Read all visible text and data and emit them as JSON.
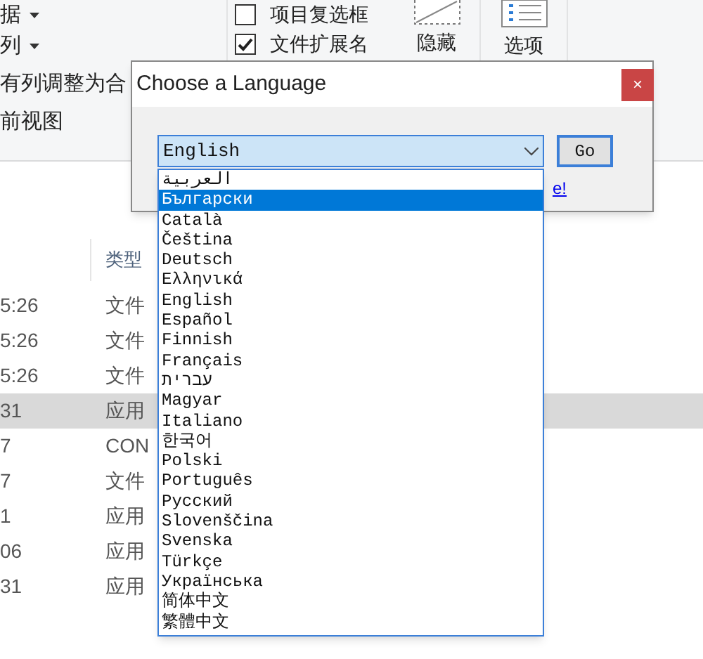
{
  "ribbon": {
    "commands": [
      {
        "label": "据",
        "dropdown": true
      },
      {
        "label": "列",
        "dropdown": true
      },
      {
        "label": "有列调整为合"
      },
      {
        "label": "前视图"
      }
    ],
    "checkboxes": [
      {
        "label": "项目复选框",
        "checked": false
      },
      {
        "label": "文件扩展名",
        "checked": true
      }
    ],
    "big_buttons": [
      {
        "label": "隐藏",
        "kind": "hide"
      },
      {
        "label": "选项",
        "kind": "options"
      }
    ]
  },
  "file_list": {
    "header": "类型",
    "rows": [
      {
        "time": "5:26",
        "type": "文件",
        "selected": false
      },
      {
        "time": "5:26",
        "type": "文件",
        "selected": false
      },
      {
        "time": "5:26",
        "type": "文件",
        "selected": false
      },
      {
        "time": "31",
        "type": "应用",
        "selected": true
      },
      {
        "time": "7",
        "type": "CON",
        "selected": false
      },
      {
        "time": "7",
        "type": "文件",
        "selected": false
      },
      {
        "time": "1",
        "type": "应用",
        "selected": false
      },
      {
        "time": "06",
        "type": "应用",
        "selected": false
      },
      {
        "time": "31",
        "type": "应用",
        "selected": false
      }
    ]
  },
  "dialog": {
    "title": "Choose a Language",
    "close": "×",
    "select_value": "English",
    "go": "Go",
    "link": "e!",
    "options": [
      {
        "label": "العربية",
        "selected": false
      },
      {
        "label": "Български",
        "selected": true
      },
      {
        "label": "Català",
        "selected": false
      },
      {
        "label": "Čeština",
        "selected": false
      },
      {
        "label": "Deutsch",
        "selected": false
      },
      {
        "label": "Ελληνικά",
        "selected": false
      },
      {
        "label": "English",
        "selected": false
      },
      {
        "label": "Español",
        "selected": false
      },
      {
        "label": "Finnish",
        "selected": false
      },
      {
        "label": "Français",
        "selected": false
      },
      {
        "label": "עברית",
        "selected": false
      },
      {
        "label": "Magyar",
        "selected": false
      },
      {
        "label": "Italiano",
        "selected": false
      },
      {
        "label": "한국어",
        "selected": false
      },
      {
        "label": "Polski",
        "selected": false
      },
      {
        "label": "Português",
        "selected": false
      },
      {
        "label": "Русский",
        "selected": false
      },
      {
        "label": "Slovenščina",
        "selected": false
      },
      {
        "label": "Svenska",
        "selected": false
      },
      {
        "label": "Türkçe",
        "selected": false
      },
      {
        "label": "Українська",
        "selected": false
      },
      {
        "label": "简体中文",
        "selected": false
      },
      {
        "label": "繁體中文",
        "selected": false
      }
    ]
  }
}
